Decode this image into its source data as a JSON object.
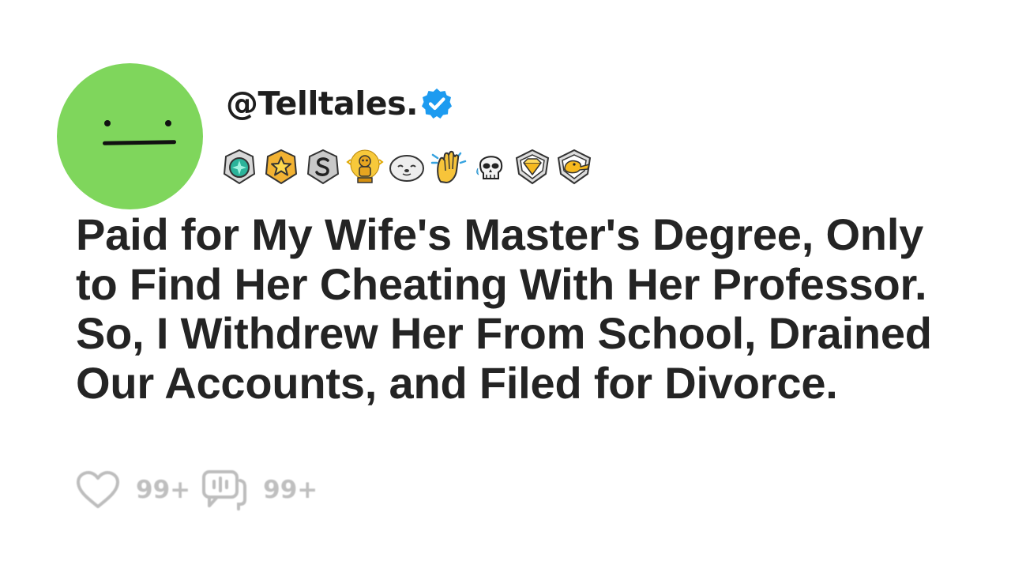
{
  "post": {
    "author": {
      "handle": "@Telltales.",
      "avatar_color": "#7fd65c",
      "verified": true,
      "verified_icon": "verified-badge-icon",
      "verified_color": "#1d9bf0"
    },
    "awards": [
      {
        "icon": "diamond-award-icon"
      },
      {
        "icon": "star-award-icon"
      },
      {
        "icon": "silver-s-award-icon"
      },
      {
        "icon": "gold-trophy-award-icon"
      },
      {
        "icon": "seal-award-icon"
      },
      {
        "icon": "clapping-hands-award-icon"
      },
      {
        "icon": "skull-laughing-award-icon"
      },
      {
        "icon": "gold-gem-award-icon"
      },
      {
        "icon": "duck-award-icon"
      }
    ],
    "title": "Paid for My Wife's Master's Degree, Only to Find Her Cheating With Her Professor. So, I Withdrew Her From School, Drained Our Accounts, and Filed for Divorce.",
    "likes": "99+",
    "comments": "99+"
  }
}
